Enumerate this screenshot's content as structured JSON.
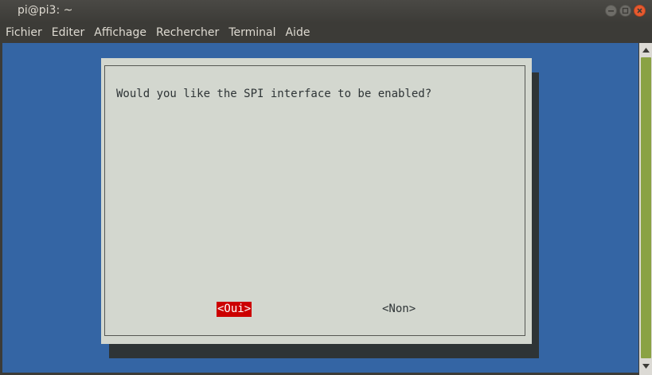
{
  "window": {
    "title": "pi@pi3: ~",
    "controls": [
      "minimize-icon",
      "maximize-icon",
      "close-icon"
    ]
  },
  "menubar": {
    "items": [
      "Fichier",
      "Editer",
      "Affichage",
      "Rechercher",
      "Terminal",
      "Aide"
    ]
  },
  "dialog": {
    "question": "Would you like the SPI interface to be enabled?",
    "yes_label": "<Oui>",
    "no_label": "<Non>",
    "selected": "yes"
  },
  "colors": {
    "terminal_bg": "#3465a4",
    "dialog_bg": "#d3d7cf",
    "selected_button_bg": "#cc0000",
    "scrollbar_thumb": "#8aa244"
  }
}
